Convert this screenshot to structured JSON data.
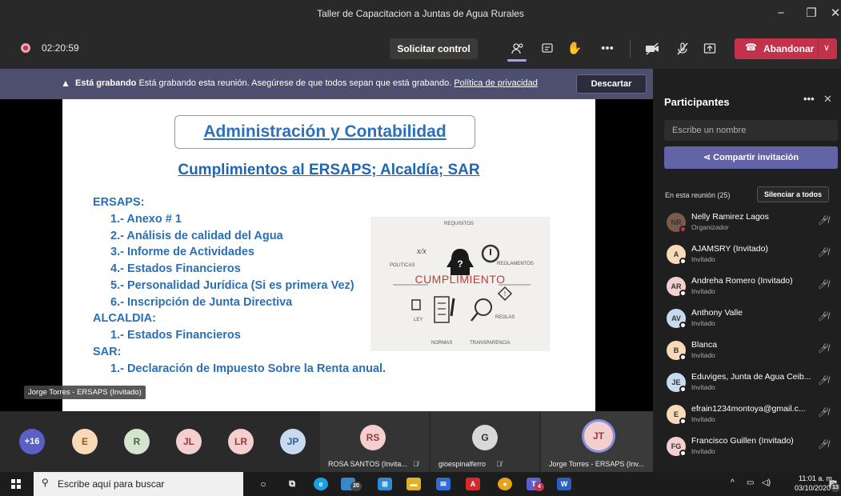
{
  "window": {
    "title": "Taller de Capacitacion a Juntas de Agua Rurales",
    "controls": [
      "−",
      "❐",
      "✕"
    ]
  },
  "toolbar": {
    "timer": "02:20:59",
    "request_control": "Solicitar control",
    "leave": "Abandonar"
  },
  "banner": {
    "bold": "Está grabando",
    "text": " Está grabando esta reunión. Asegúrese de que todos sepan que está grabando. ",
    "link": "Política de privacidad",
    "dismiss": "Descartar"
  },
  "slide": {
    "title": "Administración y Contabilidad",
    "subtitle": "Cumplimientos al  ERSAPS; Alcaldía; SAR",
    "lines": [
      "ERSAPS:",
      "1.- Anexo # 1",
      "2.- Análisis de calidad del Agua",
      "3.- Informe de Actividades",
      "4.- Estados Financieros",
      "5.- Personalidad Jurídica (Si es primera Vez)",
      "6.- Inscripción de Junta Directiva",
      "ALCALDIA:",
      "1.- Estados Financieros",
      "SAR:",
      "1.- Declaración de Impuesto Sobre la Renta anual."
    ],
    "image_words": {
      "center": "CUMPLIMIENTO",
      "requisitos": "REQUISITOS",
      "politicas": "POLITICAS",
      "reglamentos": "REGLAMENTOS",
      "ley": "LEY",
      "reglas": "REGLAS",
      "normas": "NORMAS",
      "transparencia": "TRANSPARENCIA"
    }
  },
  "presenter_label": "Jorge Torres - ERSAPS (Invitado)",
  "strip": {
    "overflow": "+16",
    "avatars": [
      "E",
      "R",
      "JL",
      "LR",
      "JP"
    ],
    "tiles": [
      {
        "initials": "RS",
        "name": "ROSA SANTOS (Invita..."
      },
      {
        "initials": "G",
        "name": "gioespinalferro"
      },
      {
        "initials": "JT",
        "name": "Jorge Torres - ERSAPS (Inv..."
      }
    ]
  },
  "panel": {
    "title": "Participantes",
    "more": "•••",
    "close": "✕",
    "search_placeholder": "Escribe un nombre",
    "share": "Compartir invitación",
    "in_meeting": "En esta reunión (25)",
    "mute_all": "Silenciar a todos",
    "participants": [
      {
        "initials": "NR",
        "name": "Nelly Ramirez Lagos",
        "role": "Organizador",
        "color": "#7a5a48"
      },
      {
        "initials": "A",
        "name": "AJAMSRY (Invitado)",
        "role": "Invitado",
        "color": "#f8d9b8"
      },
      {
        "initials": "AR",
        "name": "Andreha Romero (Invitado)",
        "role": "Invitado",
        "color": "#f4cfcf"
      },
      {
        "initials": "AV",
        "name": "Anthony Valle",
        "role": "Invitado",
        "color": "#c8daf0"
      },
      {
        "initials": "B",
        "name": "Blanca",
        "role": "Invitado",
        "color": "#f8d9b8"
      },
      {
        "initials": "JE",
        "name": "Eduviges, Junta de Agua Ceib...",
        "role": "Invitado",
        "color": "#c8daf0"
      },
      {
        "initials": "E",
        "name": "efrain1234montoya@gmail.c...",
        "role": "Invitado",
        "color": "#f8d9b8"
      },
      {
        "initials": "FG",
        "name": "Francisco Guillen (Invitado)",
        "role": "Invitado",
        "color": "#f4cfcf"
      }
    ]
  },
  "taskbar": {
    "search_placeholder": "Escribe aquí para buscar",
    "time": "11:01 a. m.",
    "date": "03/10/2020",
    "badge_photos": "20",
    "badge_teams": "4",
    "badge_notif": "13"
  }
}
